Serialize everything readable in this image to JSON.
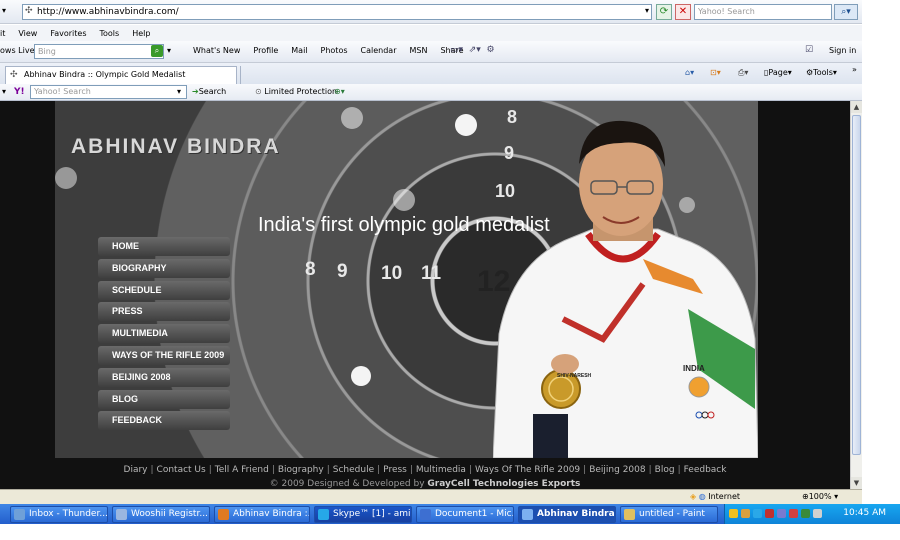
{
  "browser": {
    "url": "http://www.abhinavbindra.com/",
    "search_placeholder": "Yahoo! Search",
    "menu": [
      "it",
      "View",
      "Favorites",
      "Tools",
      "Help"
    ],
    "windows_live": {
      "label": "ows Live",
      "search_placeholder": "Bing",
      "links": [
        "What's New",
        "Profile",
        "Mail",
        "Photos",
        "Calendar",
        "MSN",
        "Share"
      ],
      "sign_in": "Sign in"
    },
    "tab_title": "Abhinav Bindra :: Olympic Gold Medalist",
    "command_bar": {
      "page": "Page",
      "tools": "Tools"
    },
    "yahoo_bar": {
      "logo": "Y!",
      "search_placeholder": "Yahoo! Search",
      "search_label": "Search",
      "protection_label": "Limited Protection"
    }
  },
  "site": {
    "logo": "ABHINAV BINDRA",
    "tagline": "India's first olympic gold medalist",
    "nav": [
      "HOME",
      "BIOGRAPHY",
      "SCHEDULE",
      "PRESS",
      "MULTIMEDIA",
      "WAYS OF THE RIFLE 2009",
      "BEIJING 2008",
      "BLOG",
      "FEEDBACK"
    ],
    "target_numbers": [
      "8",
      "9",
      "10",
      "8",
      "9",
      "10",
      "11",
      "12"
    ],
    "footer_links": [
      "Diary",
      "Contact Us",
      "Tell A Friend",
      "Biography",
      "Schedule",
      "Press",
      "Multimedia",
      "Ways Of The Rifle 2009",
      "Beijing 2008",
      "Blog",
      "Feedback"
    ],
    "footer_copy_prefix": "© 2009 Designed & Developed by",
    "footer_copy_company": "GrayCell Technologies Exports",
    "jacket_text": "INDIA",
    "sponsor_text": "SHIV-NARESH"
  },
  "status": {
    "zone": "Internet",
    "zoom": "100%"
  },
  "taskbar": {
    "items": [
      "Inbox - Thunder...",
      "Wooshii Registr...",
      "Abhinav Bindra :...",
      "Skype™ [1] - ami...",
      "Document1 - Mic...",
      "Abhinav Bindra...",
      "untitled - Paint"
    ],
    "clock": "10:45 AM"
  },
  "colors": {
    "taskbar": "#235ecc",
    "tray": "#0e83d8",
    "site_background": "#111111"
  }
}
